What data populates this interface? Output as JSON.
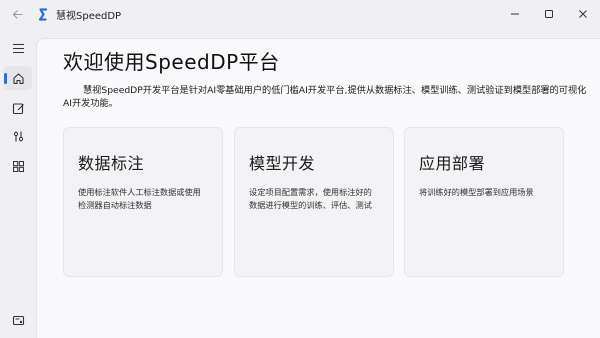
{
  "window": {
    "title": "慧视SpeedDP",
    "back_icon": "arrow-left-icon",
    "logo_color": "#2d6fd1"
  },
  "sidebar": {
    "items": [
      {
        "name": "menu",
        "icon": "hamburger-icon"
      },
      {
        "name": "home",
        "icon": "home-icon",
        "active": true
      },
      {
        "name": "annotate",
        "icon": "edit-icon"
      },
      {
        "name": "train",
        "icon": "tools-icon"
      },
      {
        "name": "deploy",
        "icon": "apps-icon"
      },
      {
        "name": "settings",
        "icon": "settings-icon"
      }
    ],
    "accent": "#2d6fd1"
  },
  "main": {
    "title": "欢迎使用SpeedDP平台",
    "description": "慧视SpeedDP开发平台是针对AI零基础用户的低门槛AI开发平台,提供从数据标注、模型训练、测试验证到模型部署的可视化AI开发功能。",
    "cards": [
      {
        "title": "数据标注",
        "desc": "使用标注软件人工标注数据或使用检测器自动标注数据"
      },
      {
        "title": "模型开发",
        "desc": "设定项目配置需求，使用标注好的数据进行模型的训练、评估、测试"
      },
      {
        "title": "应用部署",
        "desc": "将训练好的模型部署到应用场景"
      }
    ]
  }
}
